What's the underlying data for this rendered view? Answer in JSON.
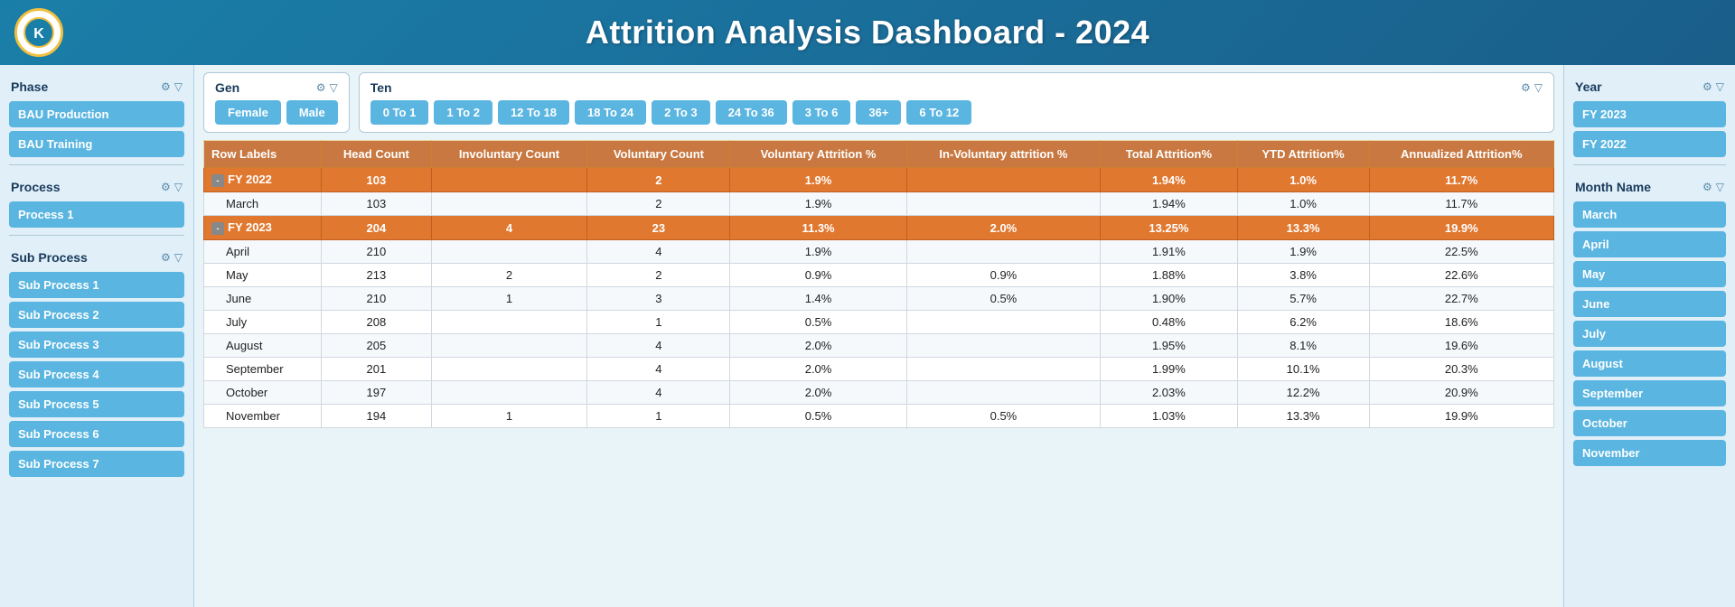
{
  "header": {
    "title": "Attrition Analysis Dashboard - 2024",
    "logo": "K"
  },
  "left_sidebar": {
    "sections": [
      {
        "key": "phase",
        "title": "Phase",
        "items": [
          "BAU Production",
          "BAU Training"
        ]
      },
      {
        "key": "process",
        "title": "Process",
        "items": [
          "Process 1"
        ]
      },
      {
        "key": "sub_process",
        "title": "Sub Process",
        "items": [
          "Sub Process 1",
          "Sub Process 2",
          "Sub Process 3",
          "Sub Process 4",
          "Sub Process 5",
          "Sub Process 6",
          "Sub Process 7"
        ]
      }
    ]
  },
  "filters": {
    "gen": {
      "title": "Gen",
      "options": [
        "Female",
        "Male"
      ]
    },
    "ten": {
      "title": "Ten",
      "options": [
        "0 To 1",
        "1 To 2",
        "12 To 18",
        "18 To 24",
        "2 To 3",
        "24 To 36",
        "3 To 6",
        "36+",
        "6 To 12"
      ]
    }
  },
  "right_sidebar": {
    "year": {
      "title": "Year",
      "options": [
        "FY 2023",
        "FY 2022"
      ]
    },
    "month": {
      "title": "Month Name",
      "options": [
        "March",
        "April",
        "May",
        "June",
        "July",
        "August",
        "September",
        "October",
        "November"
      ]
    }
  },
  "table": {
    "columns": [
      "Row Labels",
      "Head Count",
      "Involuntary Count",
      "Voluntary Count",
      "Voluntary Attrition %",
      "In-Voluntary attrition %",
      "Total Attrition%",
      "YTD Attrition%",
      "Annualized Attrition%"
    ],
    "rows": [
      {
        "type": "fy",
        "label": "FY 2022",
        "head_count": "103",
        "inv_count": "",
        "vol_count": "2",
        "vol_att": "1.9%",
        "inv_att": "",
        "total_att": "1.94%",
        "ytd_att": "1.0%",
        "ann_att": "11.7%"
      },
      {
        "type": "month",
        "label": "March",
        "head_count": "103",
        "inv_count": "",
        "vol_count": "2",
        "vol_att": "1.9%",
        "inv_att": "",
        "total_att": "1.94%",
        "ytd_att": "1.0%",
        "ann_att": "11.7%"
      },
      {
        "type": "fy",
        "label": "FY 2023",
        "head_count": "204",
        "inv_count": "4",
        "vol_count": "23",
        "vol_att": "11.3%",
        "inv_att": "2.0%",
        "total_att": "13.25%",
        "ytd_att": "13.3%",
        "ann_att": "19.9%"
      },
      {
        "type": "month",
        "label": "April",
        "head_count": "210",
        "inv_count": "",
        "vol_count": "4",
        "vol_att": "1.9%",
        "inv_att": "",
        "total_att": "1.91%",
        "ytd_att": "1.9%",
        "ann_att": "22.5%"
      },
      {
        "type": "month",
        "label": "May",
        "head_count": "213",
        "inv_count": "2",
        "vol_count": "2",
        "vol_att": "0.9%",
        "inv_att": "0.9%",
        "total_att": "1.88%",
        "ytd_att": "3.8%",
        "ann_att": "22.6%"
      },
      {
        "type": "month",
        "label": "June",
        "head_count": "210",
        "inv_count": "1",
        "vol_count": "3",
        "vol_att": "1.4%",
        "inv_att": "0.5%",
        "total_att": "1.90%",
        "ytd_att": "5.7%",
        "ann_att": "22.7%"
      },
      {
        "type": "month",
        "label": "July",
        "head_count": "208",
        "inv_count": "",
        "vol_count": "1",
        "vol_att": "0.5%",
        "inv_att": "",
        "total_att": "0.48%",
        "ytd_att": "6.2%",
        "ann_att": "18.6%"
      },
      {
        "type": "month",
        "label": "August",
        "head_count": "205",
        "inv_count": "",
        "vol_count": "4",
        "vol_att": "2.0%",
        "inv_att": "",
        "total_att": "1.95%",
        "ytd_att": "8.1%",
        "ann_att": "19.6%"
      },
      {
        "type": "month",
        "label": "September",
        "head_count": "201",
        "inv_count": "",
        "vol_count": "4",
        "vol_att": "2.0%",
        "inv_att": "",
        "total_att": "1.99%",
        "ytd_att": "10.1%",
        "ann_att": "20.3%"
      },
      {
        "type": "month",
        "label": "October",
        "head_count": "197",
        "inv_count": "",
        "vol_count": "4",
        "vol_att": "2.0%",
        "inv_att": "",
        "total_att": "2.03%",
        "ytd_att": "12.2%",
        "ann_att": "20.9%"
      },
      {
        "type": "month",
        "label": "November",
        "head_count": "194",
        "inv_count": "1",
        "vol_count": "1",
        "vol_att": "0.5%",
        "inv_att": "0.5%",
        "total_att": "1.03%",
        "ytd_att": "13.3%",
        "ann_att": "19.9%"
      }
    ]
  }
}
